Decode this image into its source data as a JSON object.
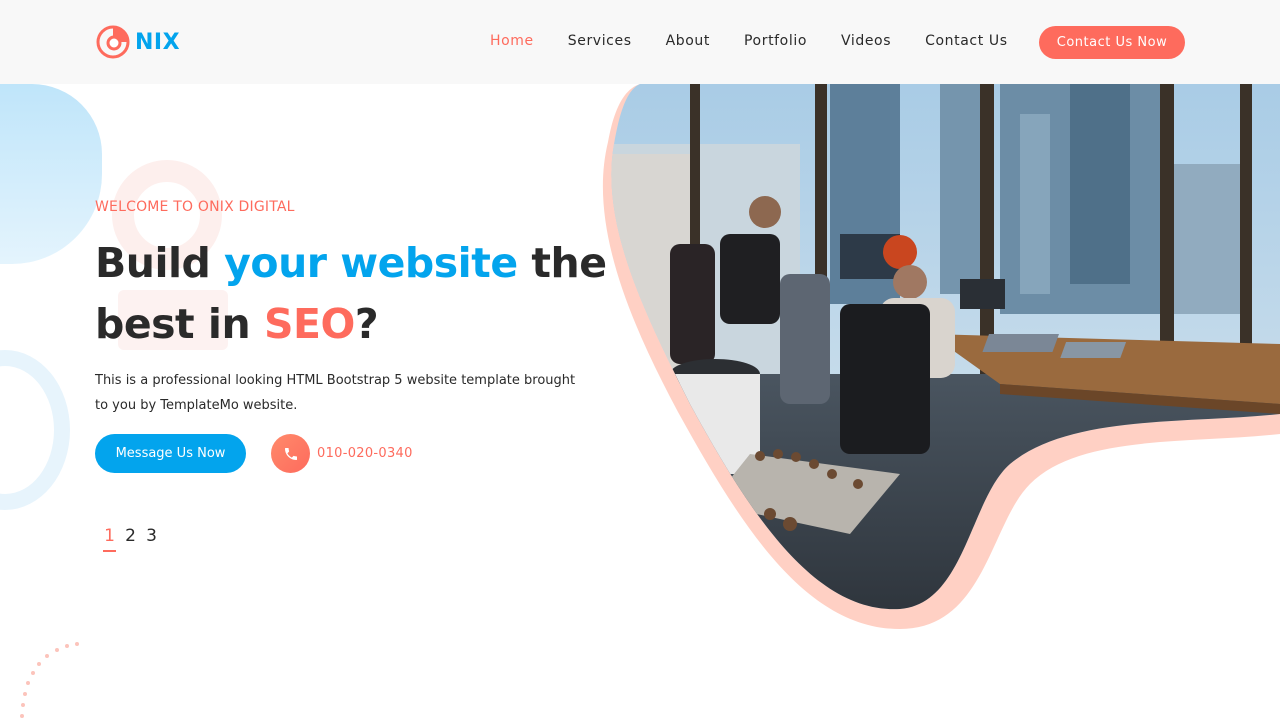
{
  "brand": {
    "name": "NIX"
  },
  "nav": {
    "items": [
      {
        "label": "Home"
      },
      {
        "label": "Services"
      },
      {
        "label": "About"
      },
      {
        "label": "Portfolio"
      },
      {
        "label": "Videos"
      },
      {
        "label": "Contact Us"
      }
    ],
    "cta_label": "Contact Us Now"
  },
  "hero": {
    "eyebrow": "WELCOME TO ONIX DIGITAL",
    "headline": {
      "part1": "Build ",
      "highlight_blue": "your website",
      "part2": " the best in ",
      "highlight_red": "SEO",
      "part3": "?"
    },
    "description": "This is a professional looking HTML Bootstrap 5 website template brought to you by TemplateMo website.",
    "message_button": "Message Us Now",
    "phone": "010-020-0340",
    "pagination": [
      "1",
      "2",
      "3"
    ],
    "active_page": "1"
  },
  "colors": {
    "accent_red": "#fe6b5d",
    "accent_blue": "#03a4ed",
    "text_dark": "#2a2a2a"
  },
  "icons": {
    "logo": "nix-logo-icon",
    "phone": "phone-icon"
  }
}
